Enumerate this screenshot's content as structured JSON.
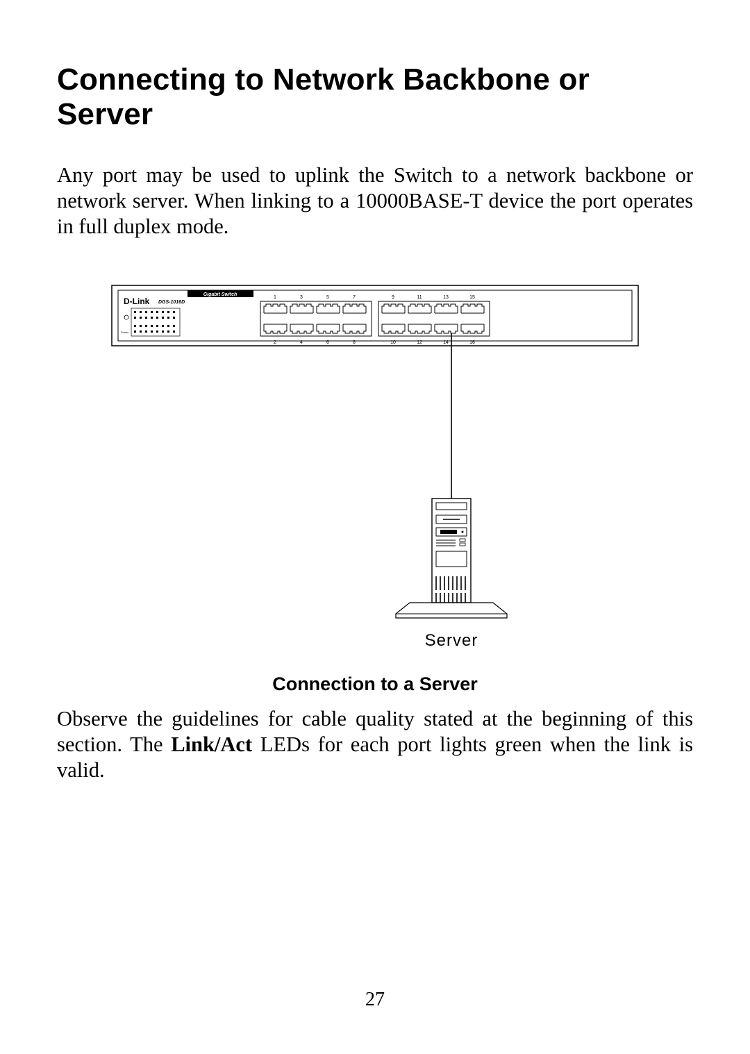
{
  "heading": "Connecting to Network Backbone or Server",
  "para1": "Any port may be used to uplink the Switch to a network backbone or network server. When linking to a 10000BASE-T device the port operates in full duplex mode.",
  "caption": "Connection to a Server",
  "para2_a": "Observe the guidelines for cable quality stated at the beginning of this section. The ",
  "para2_bold": "Link/Act",
  "para2_b": " LEDs for each port lights green when the link is valid.",
  "page_number": "27",
  "diagram": {
    "switch_brand": "D-Link",
    "switch_model": "DGS-1016D",
    "switch_banner": "Gigabit Switch",
    "led_label_small": "Power",
    "port_numbers_top": [
      "1",
      "3",
      "5",
      "7",
      "9",
      "11",
      "13",
      "15"
    ],
    "port_numbers_bottom": [
      "2",
      "4",
      "6",
      "8",
      "10",
      "12",
      "14",
      "16"
    ],
    "server_label": "Server"
  }
}
